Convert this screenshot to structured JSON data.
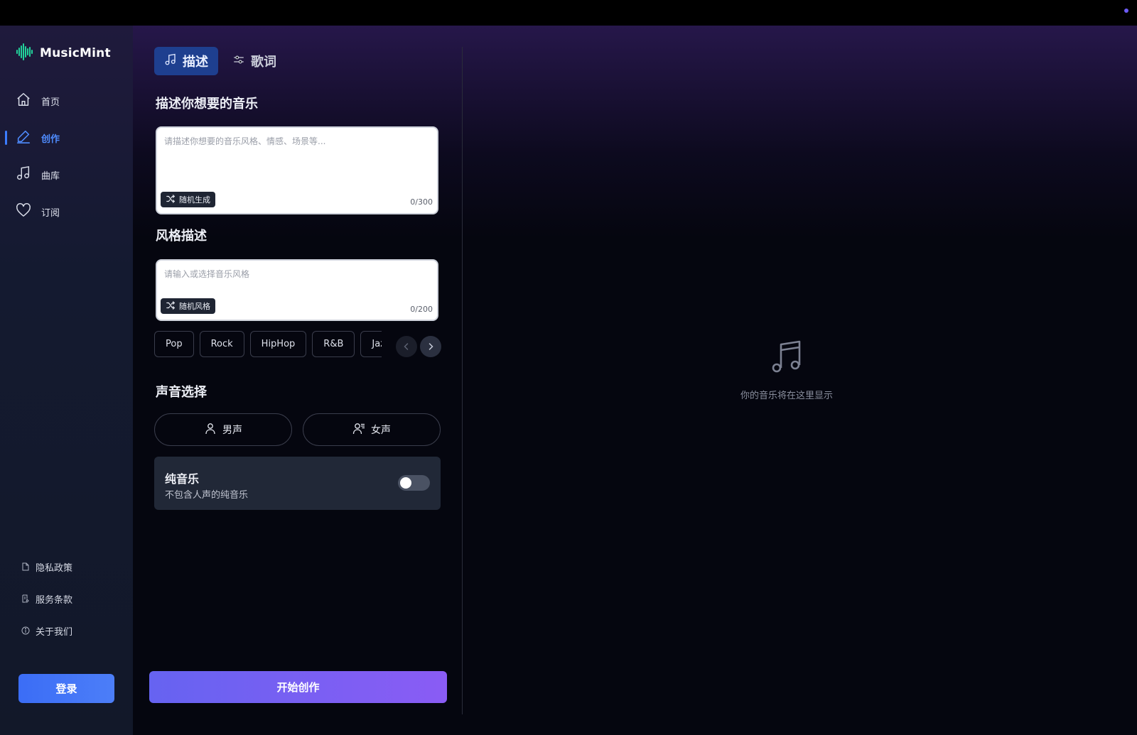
{
  "app": {
    "name": "MusicMint",
    "accent": "#3c7cff",
    "brand_color": "#22d39a"
  },
  "sidebar": {
    "nav": [
      {
        "label": "首页",
        "icon": "home-icon",
        "active": false
      },
      {
        "label": "创作",
        "icon": "pencil-icon",
        "active": true
      },
      {
        "label": "曲库",
        "icon": "music-note-icon",
        "active": false
      },
      {
        "label": "订阅",
        "icon": "heart-icon",
        "active": false
      }
    ],
    "links": [
      {
        "label": "隐私政策",
        "icon": "document-icon"
      },
      {
        "label": "服务条款",
        "icon": "document-edit-icon"
      },
      {
        "label": "关于我们",
        "icon": "info-icon"
      }
    ],
    "login_label": "登录"
  },
  "main": {
    "tabs": [
      {
        "label": "描述",
        "icon": "music-note-icon",
        "active": true
      },
      {
        "label": "歌词",
        "icon": "sliders-icon",
        "active": false
      }
    ],
    "describe": {
      "title": "描述你想要的音乐",
      "placeholder": "请描述你想要的音乐风格、情感、场景等...",
      "value": "",
      "random_label": "随机生成",
      "counter": "0/300"
    },
    "style": {
      "title": "风格描述",
      "placeholder": "请输入或选择音乐风格",
      "value": "",
      "random_label": "随机风格",
      "counter": "0/200",
      "chips": [
        "Pop",
        "Rock",
        "HipHop",
        "R&B",
        "Jazz"
      ]
    },
    "voice": {
      "title": "声音选择",
      "male_label": "男声",
      "female_label": "女声"
    },
    "instrumental": {
      "title": "纯音乐",
      "subtitle": "不包含人声的纯音乐",
      "enabled": false
    },
    "create_label": "开始创作"
  },
  "preview": {
    "empty_text": "你的音乐将在这里显示",
    "icon": "music-note-icon"
  }
}
